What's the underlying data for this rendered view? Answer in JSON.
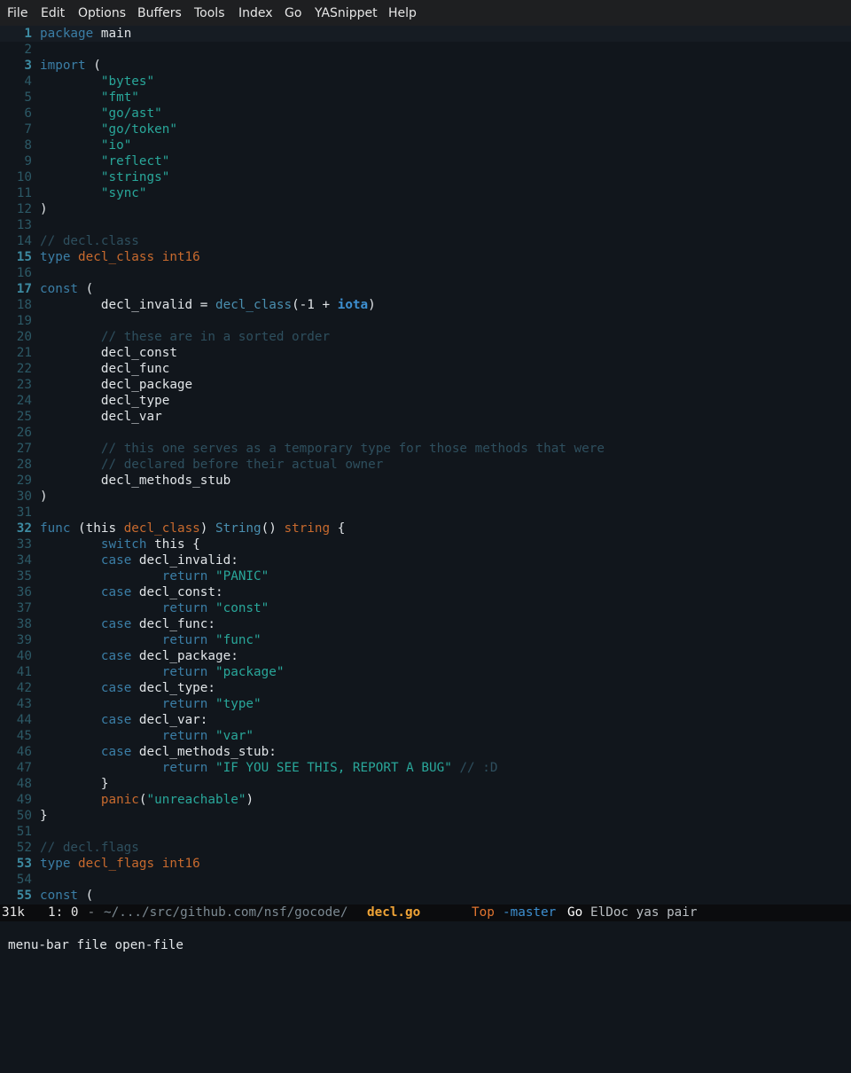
{
  "menubar": {
    "items": [
      "File",
      "Edit",
      "Options",
      "Buffers",
      "Tools",
      "Index",
      "Go",
      "YASnippet",
      "Help"
    ]
  },
  "editor": {
    "lines": [
      {
        "n": "1",
        "fold": true,
        "current": true,
        "tokens": [
          [
            "kw",
            "package"
          ],
          [
            "p",
            " main"
          ]
        ]
      },
      {
        "n": "2",
        "tokens": []
      },
      {
        "n": "3",
        "fold": true,
        "tokens": [
          [
            "kw",
            "import"
          ],
          [
            "p",
            " ("
          ]
        ]
      },
      {
        "n": "4",
        "tokens": [
          [
            "p",
            "        "
          ],
          [
            "st",
            "\"bytes\""
          ]
        ]
      },
      {
        "n": "5",
        "tokens": [
          [
            "p",
            "        "
          ],
          [
            "st",
            "\"fmt\""
          ]
        ]
      },
      {
        "n": "6",
        "tokens": [
          [
            "p",
            "        "
          ],
          [
            "st",
            "\"go/ast\""
          ]
        ]
      },
      {
        "n": "7",
        "tokens": [
          [
            "p",
            "        "
          ],
          [
            "st",
            "\"go/token\""
          ]
        ]
      },
      {
        "n": "8",
        "tokens": [
          [
            "p",
            "        "
          ],
          [
            "st",
            "\"io\""
          ]
        ]
      },
      {
        "n": "9",
        "tokens": [
          [
            "p",
            "        "
          ],
          [
            "st",
            "\"reflect\""
          ]
        ]
      },
      {
        "n": "10",
        "tokens": [
          [
            "p",
            "        "
          ],
          [
            "st",
            "\"strings\""
          ]
        ]
      },
      {
        "n": "11",
        "tokens": [
          [
            "p",
            "        "
          ],
          [
            "st",
            "\"sync\""
          ]
        ]
      },
      {
        "n": "12",
        "tokens": [
          [
            "p",
            ")"
          ]
        ]
      },
      {
        "n": "13",
        "tokens": []
      },
      {
        "n": "14",
        "tokens": [
          [
            "cm",
            "// decl.class"
          ]
        ]
      },
      {
        "n": "15",
        "fold": true,
        "tokens": [
          [
            "kw",
            "type"
          ],
          [
            "p",
            " "
          ],
          [
            "tp",
            "decl_class"
          ],
          [
            "p",
            " "
          ],
          [
            "tp",
            "int16"
          ]
        ]
      },
      {
        "n": "16",
        "tokens": []
      },
      {
        "n": "17",
        "fold": true,
        "tokens": [
          [
            "kw",
            "const"
          ],
          [
            "p",
            " ("
          ]
        ]
      },
      {
        "n": "18",
        "tokens": [
          [
            "p",
            "        decl_invalid = "
          ],
          [
            "fn",
            "decl_class"
          ],
          [
            "p",
            "(-1 + "
          ],
          [
            "kwb",
            "iota"
          ],
          [
            "p",
            ")"
          ]
        ]
      },
      {
        "n": "19",
        "tokens": []
      },
      {
        "n": "20",
        "tokens": [
          [
            "p",
            "        "
          ],
          [
            "cm",
            "// these are in a sorted order"
          ]
        ]
      },
      {
        "n": "21",
        "tokens": [
          [
            "p",
            "        decl_const"
          ]
        ]
      },
      {
        "n": "22",
        "tokens": [
          [
            "p",
            "        decl_func"
          ]
        ]
      },
      {
        "n": "23",
        "tokens": [
          [
            "p",
            "        decl_package"
          ]
        ]
      },
      {
        "n": "24",
        "tokens": [
          [
            "p",
            "        decl_type"
          ]
        ]
      },
      {
        "n": "25",
        "tokens": [
          [
            "p",
            "        decl_var"
          ]
        ]
      },
      {
        "n": "26",
        "tokens": []
      },
      {
        "n": "27",
        "tokens": [
          [
            "p",
            "        "
          ],
          [
            "cm",
            "// this one serves as a temporary type for those methods that were"
          ]
        ]
      },
      {
        "n": "28",
        "tokens": [
          [
            "p",
            "        "
          ],
          [
            "cm",
            "// declared before their actual owner"
          ]
        ]
      },
      {
        "n": "29",
        "tokens": [
          [
            "p",
            "        decl_methods_stub"
          ]
        ]
      },
      {
        "n": "30",
        "tokens": [
          [
            "p",
            ")"
          ]
        ]
      },
      {
        "n": "31",
        "tokens": []
      },
      {
        "n": "32",
        "fold": true,
        "tokens": [
          [
            "kw",
            "func"
          ],
          [
            "p",
            " (this "
          ],
          [
            "tp",
            "decl_class"
          ],
          [
            "p",
            ") "
          ],
          [
            "fn",
            "String"
          ],
          [
            "p",
            "() "
          ],
          [
            "tp",
            "string"
          ],
          [
            "p",
            " {"
          ]
        ]
      },
      {
        "n": "33",
        "tokens": [
          [
            "p",
            "        "
          ],
          [
            "kw",
            "switch"
          ],
          [
            "p",
            " this {"
          ]
        ]
      },
      {
        "n": "34",
        "tokens": [
          [
            "p",
            "        "
          ],
          [
            "kw",
            "case"
          ],
          [
            "p",
            " decl_invalid:"
          ]
        ]
      },
      {
        "n": "35",
        "tokens": [
          [
            "p",
            "                "
          ],
          [
            "kw",
            "return"
          ],
          [
            "p",
            " "
          ],
          [
            "st",
            "\"PANIC\""
          ]
        ]
      },
      {
        "n": "36",
        "tokens": [
          [
            "p",
            "        "
          ],
          [
            "kw",
            "case"
          ],
          [
            "p",
            " decl_const:"
          ]
        ]
      },
      {
        "n": "37",
        "tokens": [
          [
            "p",
            "                "
          ],
          [
            "kw",
            "return"
          ],
          [
            "p",
            " "
          ],
          [
            "st",
            "\"const\""
          ]
        ]
      },
      {
        "n": "38",
        "tokens": [
          [
            "p",
            "        "
          ],
          [
            "kw",
            "case"
          ],
          [
            "p",
            " decl_func:"
          ]
        ]
      },
      {
        "n": "39",
        "tokens": [
          [
            "p",
            "                "
          ],
          [
            "kw",
            "return"
          ],
          [
            "p",
            " "
          ],
          [
            "st",
            "\"func\""
          ]
        ]
      },
      {
        "n": "40",
        "tokens": [
          [
            "p",
            "        "
          ],
          [
            "kw",
            "case"
          ],
          [
            "p",
            " decl_package:"
          ]
        ]
      },
      {
        "n": "41",
        "tokens": [
          [
            "p",
            "                "
          ],
          [
            "kw",
            "return"
          ],
          [
            "p",
            " "
          ],
          [
            "st",
            "\"package\""
          ]
        ]
      },
      {
        "n": "42",
        "tokens": [
          [
            "p",
            "        "
          ],
          [
            "kw",
            "case"
          ],
          [
            "p",
            " decl_type:"
          ]
        ]
      },
      {
        "n": "43",
        "tokens": [
          [
            "p",
            "                "
          ],
          [
            "kw",
            "return"
          ],
          [
            "p",
            " "
          ],
          [
            "st",
            "\"type\""
          ]
        ]
      },
      {
        "n": "44",
        "tokens": [
          [
            "p",
            "        "
          ],
          [
            "kw",
            "case"
          ],
          [
            "p",
            " decl_var:"
          ]
        ]
      },
      {
        "n": "45",
        "tokens": [
          [
            "p",
            "                "
          ],
          [
            "kw",
            "return"
          ],
          [
            "p",
            " "
          ],
          [
            "st",
            "\"var\""
          ]
        ]
      },
      {
        "n": "46",
        "tokens": [
          [
            "p",
            "        "
          ],
          [
            "kw",
            "case"
          ],
          [
            "p",
            " decl_methods_stub:"
          ]
        ]
      },
      {
        "n": "47",
        "tokens": [
          [
            "p",
            "                "
          ],
          [
            "kw",
            "return"
          ],
          [
            "p",
            " "
          ],
          [
            "st",
            "\"IF YOU SEE THIS, REPORT A BUG\""
          ],
          [
            "p",
            " "
          ],
          [
            "cm",
            "// :D"
          ]
        ]
      },
      {
        "n": "48",
        "tokens": [
          [
            "p",
            "        }"
          ]
        ]
      },
      {
        "n": "49",
        "tokens": [
          [
            "p",
            "        "
          ],
          [
            "tp",
            "panic"
          ],
          [
            "p",
            "("
          ],
          [
            "st",
            "\"unreachable\""
          ],
          [
            "p",
            ")"
          ]
        ]
      },
      {
        "n": "50",
        "tokens": [
          [
            "p",
            "}"
          ]
        ]
      },
      {
        "n": "51",
        "tokens": []
      },
      {
        "n": "52",
        "tokens": [
          [
            "cm",
            "// decl.flags"
          ]
        ]
      },
      {
        "n": "53",
        "fold": true,
        "tokens": [
          [
            "kw",
            "type"
          ],
          [
            "p",
            " "
          ],
          [
            "tp",
            "decl_flags"
          ],
          [
            "p",
            " "
          ],
          [
            "tp",
            "int16"
          ]
        ]
      },
      {
        "n": "54",
        "tokens": []
      },
      {
        "n": "55",
        "fold": true,
        "tokens": [
          [
            "kw",
            "const"
          ],
          [
            "p",
            " ("
          ]
        ]
      }
    ]
  },
  "modeline": {
    "size": "31k",
    "position": "1: 0",
    "separator": " - ",
    "path": "~/.../src/github.com/nsf/gocode/",
    "filename": "decl.go",
    "scroll": "Top",
    "branch": "-master",
    "mode": "Go",
    "minor_modes": "ElDoc yas pair"
  },
  "minibuffer": {
    "text": "menu-bar file open-file"
  },
  "colors": {
    "background": "#11161c",
    "keyword": "#3b7ea6",
    "type": "#c86a2e",
    "string": "#29a79a",
    "comment": "#2e4f5e",
    "filename": "#f0a436"
  }
}
